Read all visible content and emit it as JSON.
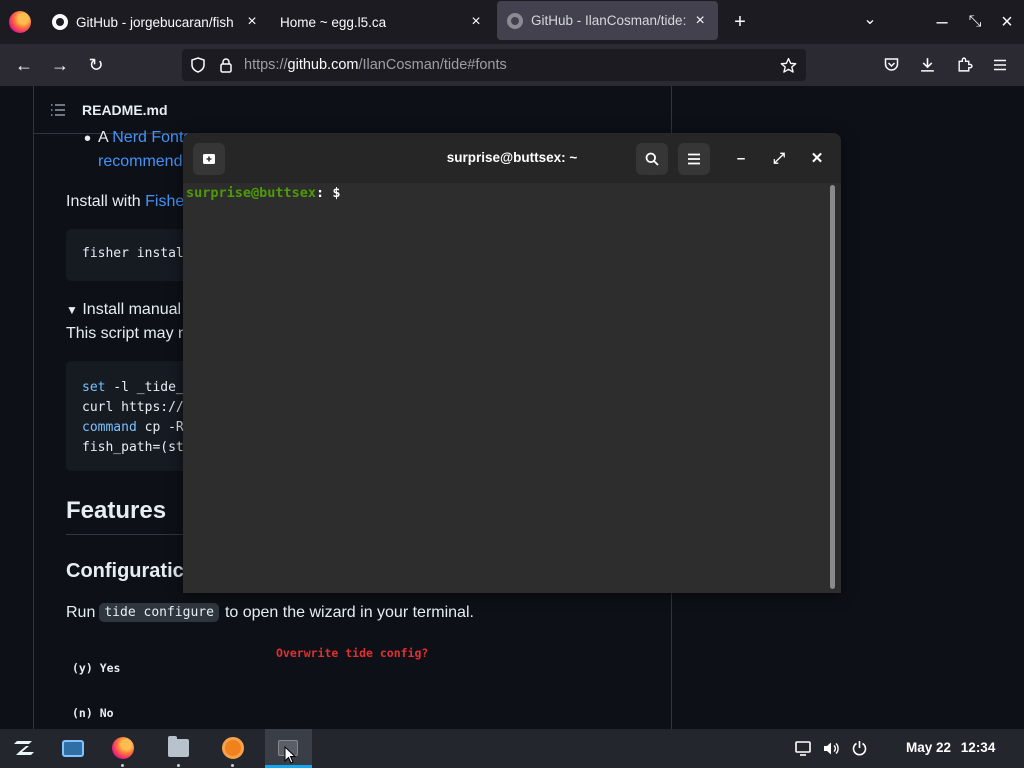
{
  "browser": {
    "tabs": [
      {
        "title": "GitHub - jorgebucaran/fish",
        "close": "×"
      },
      {
        "title": "Home ~ egg.l5.ca",
        "close": "×"
      },
      {
        "title": "GitHub - IlanCosman/tide:",
        "close": "×"
      }
    ],
    "new_tab": "+",
    "tab_list": "⌄",
    "window_controls": {
      "minimize": "–",
      "restore": "⤡",
      "close": "×"
    },
    "nav": {
      "back": "←",
      "forward": "→",
      "reload": "↻"
    },
    "url": {
      "prefix": "https://",
      "host": "github.com",
      "path": "/IlanCosman/tide#fonts"
    },
    "toolbar_icons": [
      "shield-icon",
      "lock-icon",
      "star-icon",
      "pocket-icon",
      "download-icon",
      "extensions-icon",
      "menu-icon"
    ]
  },
  "readme": {
    "title": "README.md",
    "bullet_a": "A",
    "nerd_fonts_link": "Nerd Fonts",
    "recommended_link": "recommended",
    "install_with": "Install with",
    "fisher_link": "Fisher",
    "fisher_code": "fisher install",
    "install_manually": "Install manual",
    "script_note": "This script may n",
    "code_lines": [
      {
        "kw": "set",
        "rest": " -l _tide_"
      },
      {
        "kw": "",
        "rest": "curl https://"
      },
      {
        "kw": "command",
        "rest": " cp -R"
      },
      {
        "kw": "",
        "rest": "fish_path=(st"
      }
    ],
    "features_heading": "Features",
    "configuration_heading": "Configuratic",
    "run_text": "Run",
    "run_code": "tide configure",
    "run_rest": "to open the wizard in your terminal.",
    "wizard_prompt": "Overwrite tide config?",
    "wizard_yes": "(y) Yes",
    "wizard_no": "(n) No"
  },
  "terminal": {
    "title": "surprise@buttsex: ~",
    "prompt_user": "surprise@buttsex",
    "prompt_sep": ":",
    "prompt_dir": " $",
    "buttons": {
      "new_tab": "new-tab-icon",
      "search": "search-icon",
      "menu": "hamburger-icon",
      "minimize": "–",
      "maximize": "⤢",
      "close": "✕"
    }
  },
  "taskbar": {
    "date": "May 22",
    "time": "12:34",
    "apps": [
      "zorin-menu-icon",
      "workspaces-icon",
      "firefox-icon",
      "files-icon",
      "software-icon",
      "terminal-icon"
    ],
    "tray": [
      "display-icon",
      "volume-icon",
      "power-icon"
    ]
  },
  "colors": {
    "link": "#4493f8",
    "terminal_user": "#4e9a06",
    "terminal_path": "#3465a4",
    "wizard_warning": "#e0302f"
  }
}
